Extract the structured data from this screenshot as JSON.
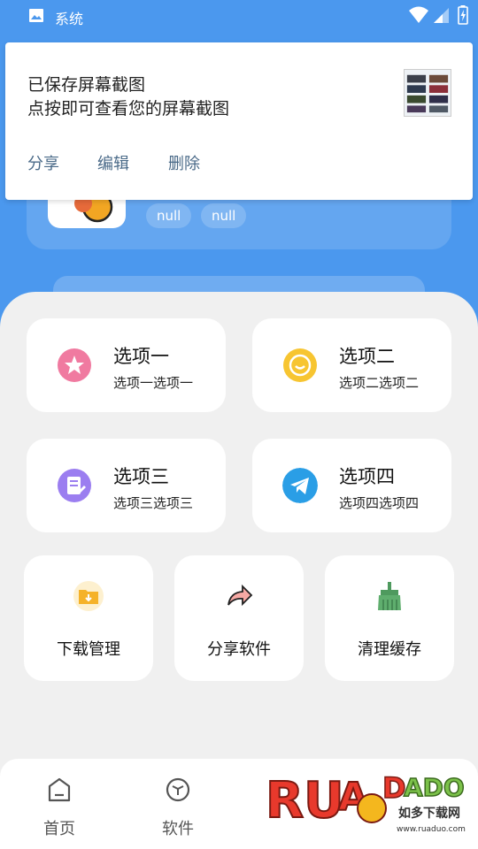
{
  "status_bar": {
    "app_label": "系统"
  },
  "header": {
    "chips": [
      "null",
      "null"
    ]
  },
  "notification": {
    "title": "已保存屏幕截图",
    "text": "点按即可查看您的屏幕截图",
    "actions": [
      "分享",
      "编辑",
      "删除"
    ]
  },
  "options": [
    {
      "title": "选项一",
      "subtitle": "选项一选项一",
      "icon": "star-icon",
      "color": "#f07aa0"
    },
    {
      "title": "选项二",
      "subtitle": "选项二选项二",
      "icon": "chat-bubble-icon",
      "color": "#f7c531"
    },
    {
      "title": "选项三",
      "subtitle": "选项三选项三",
      "icon": "document-icon",
      "color": "#9b7ef0"
    },
    {
      "title": "选项四",
      "subtitle": "选项四选项四",
      "icon": "telegram-icon",
      "color": "#2a9ee6"
    }
  ],
  "tools": [
    {
      "label": "下载管理",
      "icon": "download-folder-icon"
    },
    {
      "label": "分享软件",
      "icon": "share-arrow-icon"
    },
    {
      "label": "清理缓存",
      "icon": "broom-icon"
    }
  ],
  "bottom_nav": [
    {
      "label": "首页",
      "icon": "home-icon"
    },
    {
      "label": "软件",
      "icon": "cube-icon"
    }
  ],
  "watermark": {
    "brand": "RUANDADUO",
    "name": "如多下载网",
    "url": "www.ruaduo.com"
  },
  "colors": {
    "primary": "#4b98ee",
    "sheet_bg": "#f0f0f0",
    "notification_action": "#4a6a88"
  }
}
